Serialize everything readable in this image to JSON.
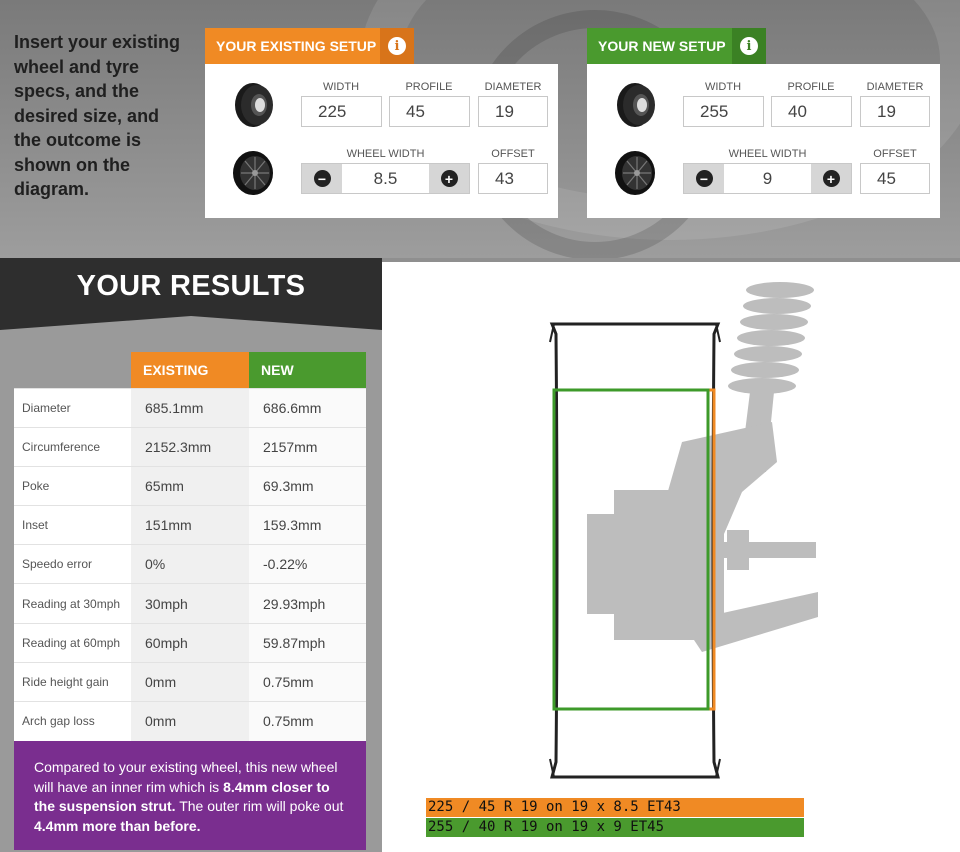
{
  "intro": {
    "text": "Insert your existing wheel and tyre specs, and the desired size, and the outcome is shown on the diagram."
  },
  "existing": {
    "tab_label": "YOUR EXISTING SETUP",
    "width_label": "WIDTH",
    "width": "225",
    "profile_label": "PROFILE",
    "profile": "45",
    "diameter_label": "DIAMETER",
    "diameter": "19",
    "wheel_width_label": "WHEEL WIDTH",
    "wheel_width": "8.5",
    "offset_label": "OFFSET",
    "offset": "43"
  },
  "new": {
    "tab_label": "YOUR NEW SETUP",
    "width_label": "WIDTH",
    "width": "255",
    "profile_label": "PROFILE",
    "profile": "40",
    "diameter_label": "DIAMETER",
    "diameter": "19",
    "wheel_width_label": "WHEEL WIDTH",
    "wheel_width": "9",
    "offset_label": "OFFSET",
    "offset": "45"
  },
  "results": {
    "title": "YOUR RESULTS",
    "col_existing": "EXISTING",
    "col_new": "NEW",
    "rows": [
      {
        "name": "Diameter",
        "existing": "685.1mm",
        "new": "686.6mm"
      },
      {
        "name": "Circumference",
        "existing": "2152.3mm",
        "new": "2157mm"
      },
      {
        "name": "Poke",
        "existing": "65mm",
        "new": "69.3mm"
      },
      {
        "name": "Inset",
        "existing": "151mm",
        "new": "159.3mm"
      },
      {
        "name": "Speedo error",
        "existing": "0%",
        "new": "-0.22%"
      },
      {
        "name": "Reading at 30mph",
        "existing": "30mph",
        "new": "29.93mph"
      },
      {
        "name": "Reading at 60mph",
        "existing": "60mph",
        "new": "59.87mph"
      },
      {
        "name": "Ride height gain",
        "existing": "0mm",
        "new": "0.75mm"
      },
      {
        "name": "Arch gap loss",
        "existing": "0mm",
        "new": "0.75mm"
      }
    ],
    "summary": {
      "p1": "Compared to your existing wheel, this new wheel will have an inner rim which is ",
      "b1": "8.4mm closer to the suspension strut.",
      "p2": " The outer rim will poke out ",
      "b2": "4.4mm more than before."
    }
  },
  "diagram": {
    "legend_existing": "225 / 45 R 19 on 19 x 8.5 ET43",
    "legend_new": "255 / 40 R 19 on 19 x 9 ET45"
  },
  "colors": {
    "orange": "#f08a24",
    "green": "#4a9a2e",
    "purple": "#7a2e8f",
    "dark": "#2e2e2e"
  },
  "icons": [
    "info-icon",
    "minus-icon",
    "plus-icon",
    "tyre-icon",
    "wheel-icon"
  ]
}
